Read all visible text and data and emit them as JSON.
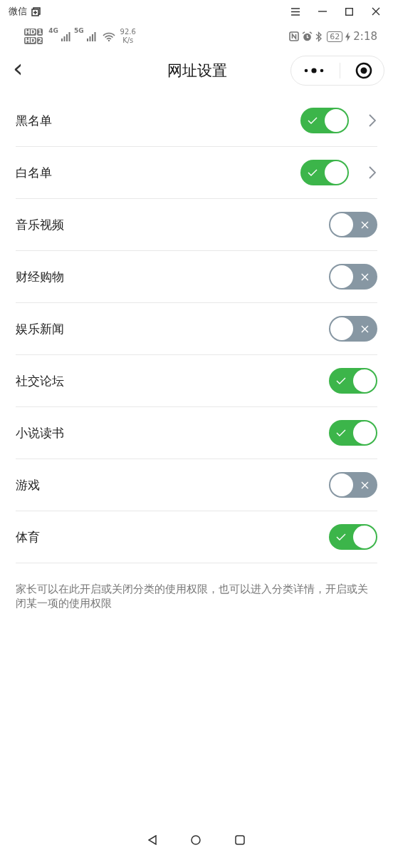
{
  "window": {
    "title": "微信"
  },
  "status_bar": {
    "sim_labels": [
      "HD",
      "HD"
    ],
    "sim_numbers": [
      "1",
      "2"
    ],
    "networks": [
      "4G",
      "5G"
    ],
    "speed": "92.6",
    "speed_unit": "K/s",
    "battery": "62",
    "time": "2:18"
  },
  "nav": {
    "back": "‹",
    "title": "网址设置"
  },
  "rows": [
    {
      "label": "黑名单",
      "kind": "link",
      "on": true
    },
    {
      "label": "白名单",
      "kind": "link",
      "on": true
    },
    {
      "label": "音乐视频",
      "kind": "switch",
      "on": false
    },
    {
      "label": "财经购物",
      "kind": "switch",
      "on": false
    },
    {
      "label": "娱乐新闻",
      "kind": "switch",
      "on": false
    },
    {
      "label": "社交论坛",
      "kind": "switch",
      "on": true
    },
    {
      "label": "小说读书",
      "kind": "switch",
      "on": true
    },
    {
      "label": "游戏",
      "kind": "switch",
      "on": false
    },
    {
      "label": "体育",
      "kind": "switch",
      "on": true
    }
  ],
  "note": "家长可以在此开启或关闭分类的使用权限，也可以进入分类详情，开启或关闭某一项的使用权限"
}
